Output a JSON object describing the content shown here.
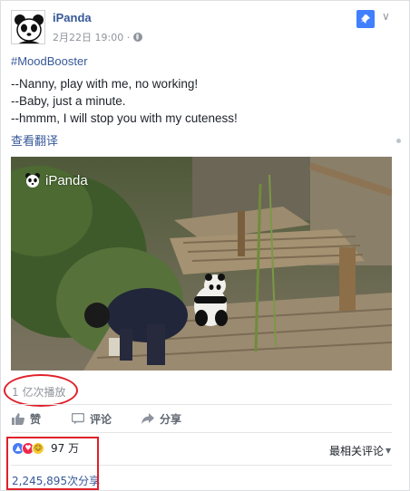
{
  "post": {
    "page_name": "iPanda",
    "timestamp": "2月22日 19:00 ·",
    "privacy_icon": "globe-icon",
    "hashtag": "#MoodBooster",
    "lines": [
      "--Nanny, play with me, no working!",
      "--Baby, just a minute.",
      "--hmmm, I will stop you with my cuteness!"
    ],
    "translate_link": "查看翻译"
  },
  "video": {
    "watermark": "iPanda",
    "views": "1 亿次播放"
  },
  "actions": {
    "like": "赞",
    "comment": "评论",
    "share": "分享"
  },
  "stats": {
    "reactions_count": "97 万",
    "sort_label": "最相关评论",
    "shares": "2,245,895次分享"
  },
  "colors": {
    "link": "#365899",
    "pin": "#4080ff",
    "annotation": "#e0202a"
  }
}
